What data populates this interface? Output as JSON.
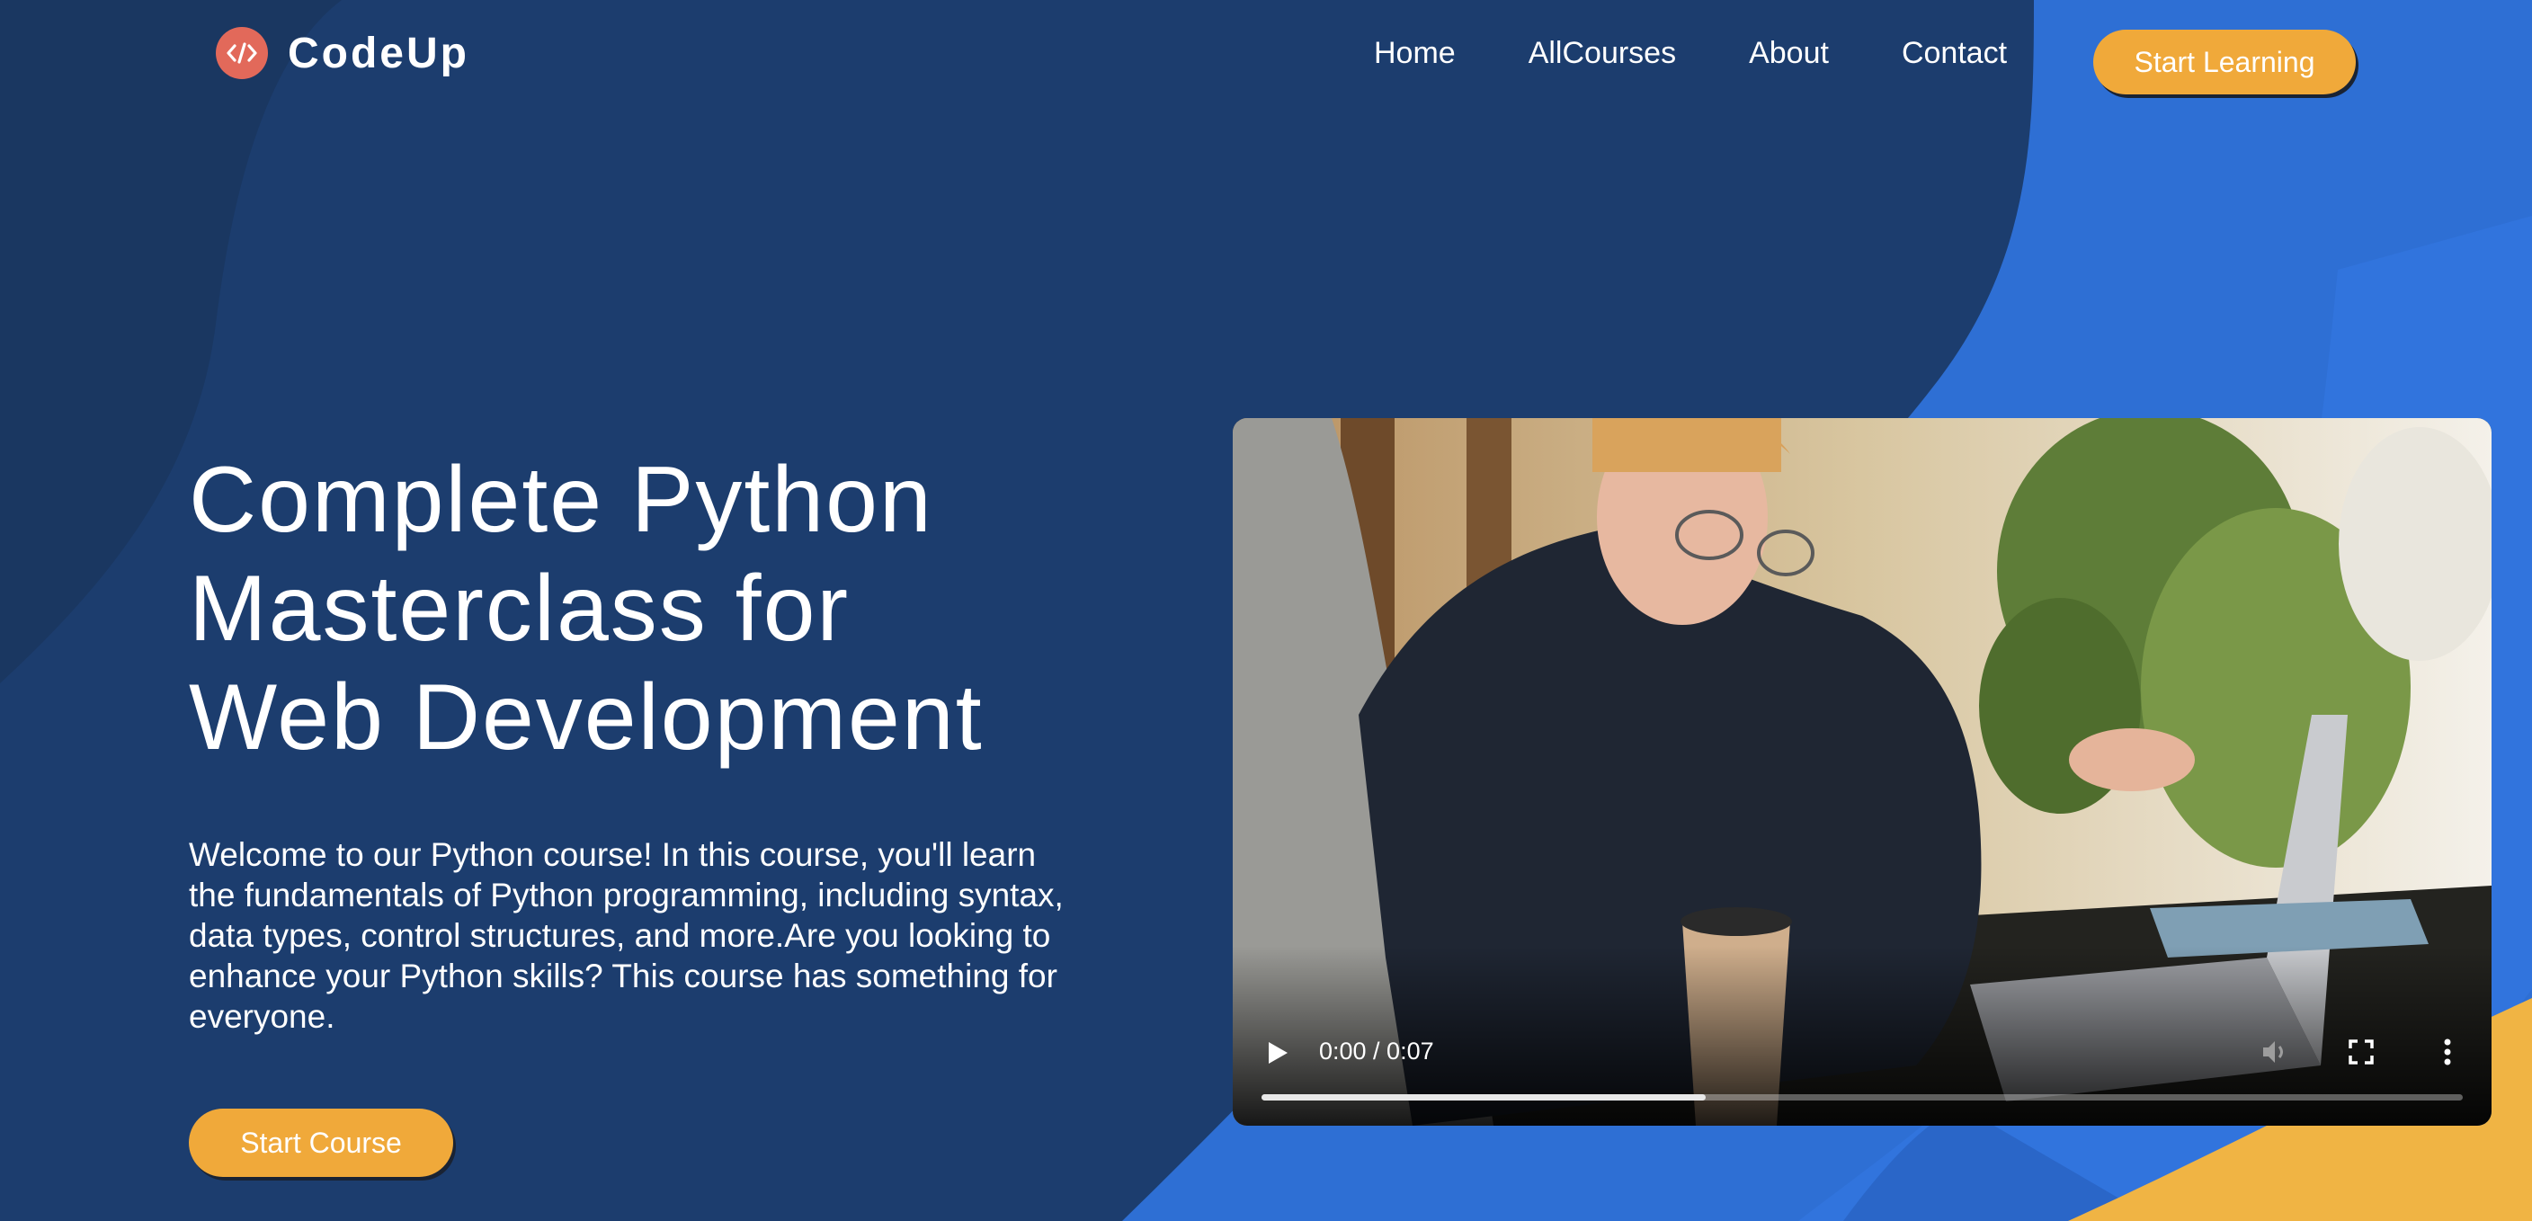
{
  "colors": {
    "background_dark": "#1c3d6e",
    "background_blue": "#2e6fd4",
    "accent_orange": "#f0a93a",
    "logo_red": "#e2695a",
    "text": "#ffffff"
  },
  "header": {
    "logo": {
      "icon": "code-brackets-icon",
      "text": "CodeUp"
    },
    "nav": [
      {
        "label": "Home"
      },
      {
        "label": "AllCourses"
      },
      {
        "label": "About"
      },
      {
        "label": "Contact"
      }
    ],
    "cta_label": "Start Learning"
  },
  "hero": {
    "title_lines": [
      "Complete Python",
      "Masterclass for",
      "Web Development"
    ],
    "description": "Welcome to our Python course! In this course, you'll learn the fundamentals of Python programming, including syntax, data types, control structures, and more.Are you looking to enhance your Python skills? This course has something for everyone.",
    "cta_label": "Start Course"
  },
  "video": {
    "time_display": "0:00 / 0:07",
    "buffered_fraction": 0.37,
    "icons": [
      "play-icon",
      "volume-icon",
      "fullscreen-icon",
      "more-options-icon"
    ]
  }
}
